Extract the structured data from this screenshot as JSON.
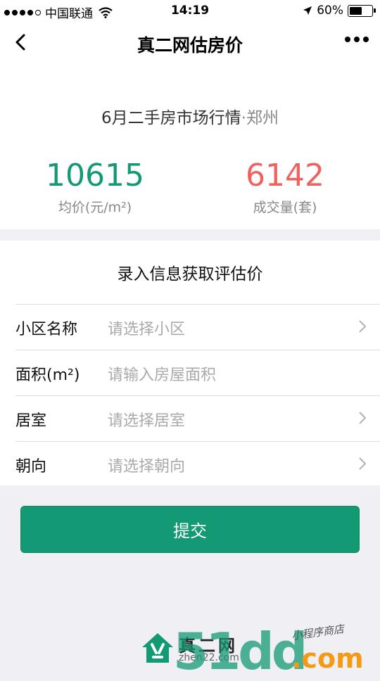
{
  "status_bar": {
    "carrier": "中国联通",
    "time": "14:19",
    "battery": "60%",
    "battery_level": 0.6
  },
  "nav": {
    "title": "真二网估房价",
    "back_icon": "chevron-left-icon",
    "more_icon": "more-dots-icon"
  },
  "market": {
    "title": "6月二手房市场行情",
    "separator": "·",
    "city": "郑州",
    "avg_price": {
      "value": "10615",
      "label": "均价(元/m²)",
      "color": "#139a74"
    },
    "volume": {
      "value": "6142",
      "label": "成交量(套)",
      "color": "#f0625f"
    }
  },
  "form": {
    "title": "录入信息获取评估价",
    "fields": [
      {
        "label": "小区名称",
        "placeholder": "请选择小区",
        "has_chevron": true
      },
      {
        "label": "面积(m²)",
        "placeholder": "请输入房屋面积",
        "has_chevron": false
      },
      {
        "label": "居室",
        "placeholder": "请选择居室",
        "has_chevron": true
      },
      {
        "label": "朝向",
        "placeholder": "请选择朝向",
        "has_chevron": true
      }
    ],
    "submit_label": "提交"
  },
  "footer": {
    "brand": "真二网",
    "domain": "zhen22.com"
  },
  "watermark": {
    "digits": "51dd",
    "suffix": ".com",
    "note": "小程序商店"
  },
  "colors": {
    "accent": "#139a74",
    "highlight": "#f0625f",
    "background": "#efeff4"
  }
}
